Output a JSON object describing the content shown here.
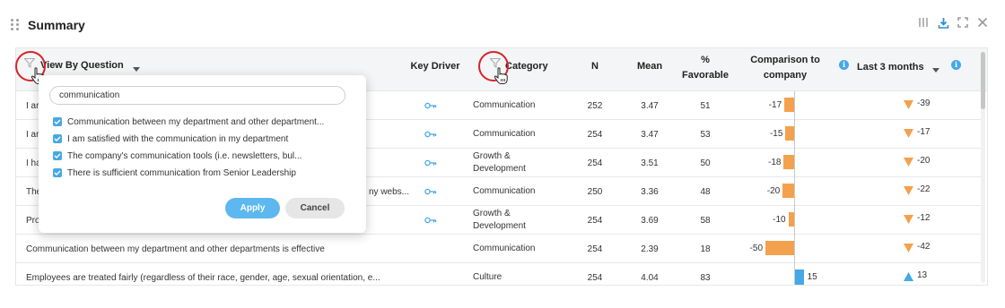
{
  "header": {
    "title": "Summary"
  },
  "table": {
    "columns": {
      "question": "View By Question",
      "key_driver": "Key Driver",
      "category": "Category",
      "n": "N",
      "mean": "Mean",
      "pct_favorable": [
        "%",
        "Favorable"
      ],
      "comparison": [
        "Comparison to",
        "company"
      ],
      "period": "Last 3 months"
    },
    "rows": [
      {
        "question": "I ar",
        "key_driver": true,
        "category": [
          "Communication"
        ],
        "n": "252",
        "mean": "3.47",
        "favorable": "51",
        "comparison": -17,
        "trend": -39
      },
      {
        "question": "I ar",
        "key_driver": true,
        "category": [
          "Communication"
        ],
        "n": "254",
        "mean": "3.47",
        "favorable": "53",
        "comparison": -15,
        "trend": -17
      },
      {
        "question": "I ha",
        "key_driver": true,
        "category": [
          "Growth &",
          "Development"
        ],
        "n": "254",
        "mean": "3.51",
        "favorable": "50",
        "comparison": -18,
        "trend": -20
      },
      {
        "question": "The",
        "question_tail": "ny webs...",
        "key_driver": true,
        "category": [
          "Communication"
        ],
        "n": "250",
        "mean": "3.36",
        "favorable": "48",
        "comparison": -20,
        "trend": -22
      },
      {
        "question": "Pro",
        "key_driver": true,
        "category": [
          "Growth &",
          "Development"
        ],
        "n": "254",
        "mean": "3.69",
        "favorable": "58",
        "comparison": -10,
        "trend": -12
      },
      {
        "question": "Communication between my department and other departments is effective",
        "key_driver": false,
        "category": [
          "Communication"
        ],
        "n": "254",
        "mean": "2.39",
        "favorable": "18",
        "comparison": -50,
        "trend": -42
      },
      {
        "question": "Employees are treated fairly (regardless of their race, gender, age, sexual orientation, e...",
        "key_driver": false,
        "category": [
          "Culture"
        ],
        "n": "254",
        "mean": "4.04",
        "favorable": "83",
        "comparison": 15,
        "trend": 13
      }
    ]
  },
  "filter_popup": {
    "search_value": "communication",
    "options": [
      {
        "label": "Communication between my department and other department...",
        "checked": true
      },
      {
        "label": "I am satisfied with the communication in my department",
        "checked": true
      },
      {
        "label": "The company's communication tools (i.e. newsletters, bul...",
        "checked": true
      },
      {
        "label": "There is sufficient communication from Senior Leadership",
        "checked": true
      }
    ],
    "apply_label": "Apply",
    "cancel_label": "Cancel"
  },
  "colors": {
    "negative_bar": "#f4a14d",
    "positive_bar": "#46a8e6",
    "accent": "#46a8e6",
    "highlight_ring": "#d8232a"
  },
  "icons": [
    "drag-handle-icon",
    "columns-icon",
    "download-icon",
    "expand-icon",
    "close-icon",
    "filter-icon",
    "chevron-down-icon",
    "key-icon",
    "info-icon",
    "triangle-down-icon",
    "triangle-up-icon",
    "checkmark-icon"
  ]
}
